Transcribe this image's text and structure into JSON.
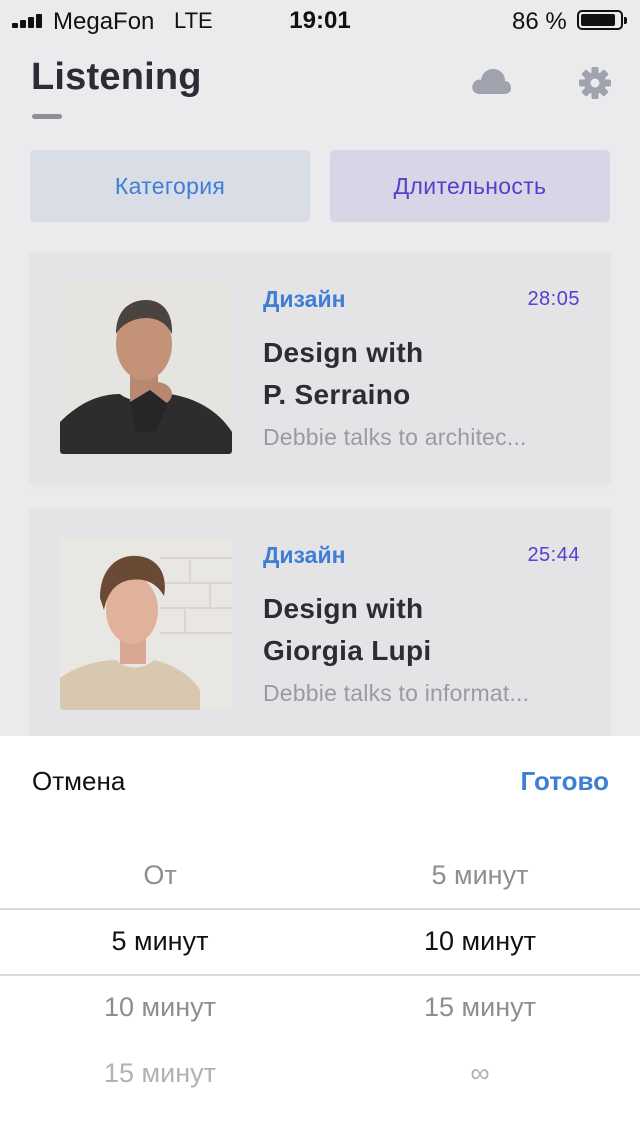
{
  "status_bar": {
    "carrier": "MegaFon",
    "network": "LTE",
    "time": "19:01",
    "battery": "86 %"
  },
  "header": {
    "title": "Listening",
    "cloud_icon": "cloud-icon",
    "settings_icon": "gear-icon"
  },
  "filters": {
    "category_label": "Категория",
    "duration_label": "Длительность"
  },
  "episodes": [
    {
      "category": "Дизайн",
      "duration": "28:05",
      "title": "Design with\nP. Serraino",
      "description": "Debbie talks to architec..."
    },
    {
      "category": "Дизайн",
      "duration": "25:44",
      "title": "Design with\nGiorgia Lupi",
      "description": "Debbie talks to informat..."
    }
  ],
  "picker": {
    "cancel_label": "Отмена",
    "done_label": "Готово",
    "from_column": [
      "От",
      "5 минут",
      "10 минут",
      "15 минут"
    ],
    "to_column": [
      "5 минут",
      "10 минут",
      "15 минут",
      "∞"
    ],
    "selected_from": "5 минут",
    "selected_to": "10 минут"
  },
  "colors": {
    "accent_blue": "#3f7ed7",
    "accent_purple": "#5440cc",
    "background": "#ebebed",
    "text_dark": "#2b2d36"
  }
}
